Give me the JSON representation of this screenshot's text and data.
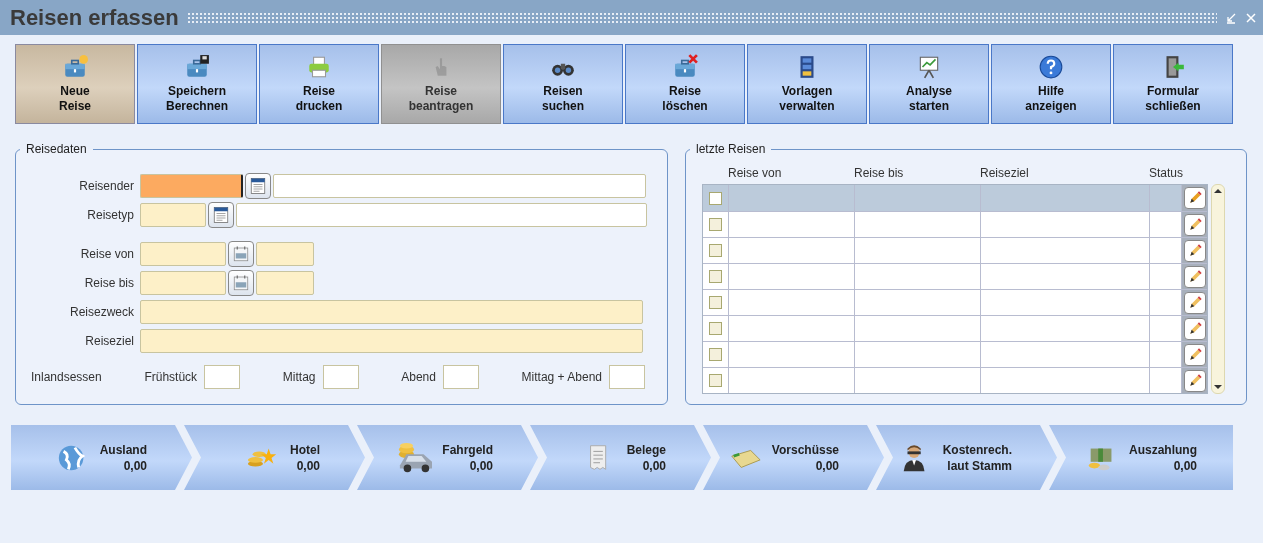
{
  "window": {
    "title": "Reisen erfassen"
  },
  "toolbar": [
    {
      "lines": [
        "Neue",
        "Reise"
      ],
      "selected": true,
      "disabled": false
    },
    {
      "lines": [
        "Speichern",
        "Berechnen"
      ],
      "selected": false,
      "disabled": false
    },
    {
      "lines": [
        "Reise",
        "drucken"
      ],
      "selected": false,
      "disabled": false
    },
    {
      "lines": [
        "Reise",
        "beantragen"
      ],
      "selected": false,
      "disabled": true
    },
    {
      "lines": [
        "Reisen",
        "suchen"
      ],
      "selected": false,
      "disabled": false
    },
    {
      "lines": [
        "Reise",
        "löschen"
      ],
      "selected": false,
      "disabled": false
    },
    {
      "lines": [
        "Vorlagen",
        "verwalten"
      ],
      "selected": false,
      "disabled": false
    },
    {
      "lines": [
        "Analyse",
        "starten"
      ],
      "selected": false,
      "disabled": false
    },
    {
      "lines": [
        "Hilfe",
        "anzeigen"
      ],
      "selected": false,
      "disabled": false
    },
    {
      "lines": [
        "Formular",
        "schließen"
      ],
      "selected": false,
      "disabled": false
    }
  ],
  "reisedaten": {
    "legend": "Reisedaten",
    "fields": [
      {
        "label": "Reisender",
        "kind": "lookup",
        "focused": true
      },
      {
        "label": "Reisetyp",
        "kind": "lookup",
        "focused": false
      },
      {
        "label": "Reise von",
        "kind": "date",
        "focused": false
      },
      {
        "label": "Reise bis",
        "kind": "date",
        "focused": false
      },
      {
        "label": "Reisezweck",
        "kind": "text",
        "focused": false
      },
      {
        "label": "Reiseziel",
        "kind": "text",
        "focused": false
      }
    ],
    "meals": {
      "label": "Inlandsessen",
      "items": [
        {
          "label": "Frühstück"
        },
        {
          "label": "Mittag"
        },
        {
          "label": "Abend"
        },
        {
          "label": "Mittag + Abend"
        }
      ]
    }
  },
  "letzte_reisen": {
    "legend": "letzte Reisen",
    "columns": [
      "Reise von",
      "Reise bis",
      "Reiseziel",
      "Status"
    ],
    "rows": [
      {
        "selected": true,
        "checked": false
      },
      {
        "selected": false,
        "checked": false
      },
      {
        "selected": false,
        "checked": false
      },
      {
        "selected": false,
        "checked": false
      },
      {
        "selected": false,
        "checked": false
      },
      {
        "selected": false,
        "checked": false
      },
      {
        "selected": false,
        "checked": false
      },
      {
        "selected": false,
        "checked": false
      }
    ]
  },
  "steps": [
    {
      "title": "Ausland",
      "value": "0,00"
    },
    {
      "title": "Hotel",
      "value": "0,00"
    },
    {
      "title": "Fahrgeld",
      "value": "0,00"
    },
    {
      "title": "Belege",
      "value": "0,00"
    },
    {
      "title": "Vorschüsse",
      "value": "0,00"
    },
    {
      "title": "Kostenrech.",
      "value": "laut Stamm"
    },
    {
      "title": "Auszahlung",
      "value": "0,00"
    }
  ]
}
